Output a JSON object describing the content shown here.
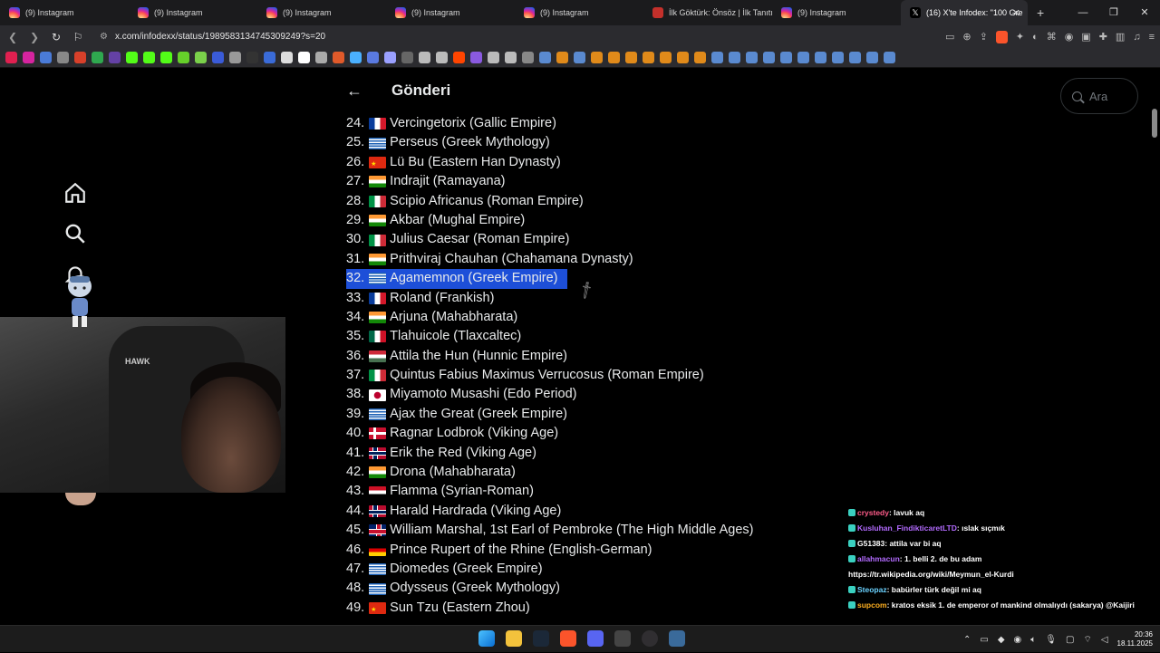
{
  "browser": {
    "tabs": [
      {
        "title": "(9) Instagram",
        "icon": "instagram-icon"
      },
      {
        "title": "(9) Instagram",
        "icon": "instagram-icon"
      },
      {
        "title": "(9) Instagram",
        "icon": "instagram-icon"
      },
      {
        "title": "(9) Instagram",
        "icon": "instagram-icon"
      },
      {
        "title": "(9) Instagram",
        "icon": "instagram-icon"
      },
      {
        "title": "İlk Göktürk: Önsöz | İlk Tanıtım",
        "icon": "youtube-icon"
      },
      {
        "title": "(9) Instagram",
        "icon": "instagram-icon"
      },
      {
        "title": "(16) X'te Infodex: \"100 Gre",
        "icon": "x-icon",
        "active": true
      }
    ],
    "url": "x.com/infodexx/status/1989583134745309249?s=20"
  },
  "header": {
    "back_icon": "arrow-left-icon",
    "title": "Gönderi"
  },
  "search": {
    "placeholder": "Ara"
  },
  "list": [
    {
      "num": "24.",
      "flag": "fr",
      "text": "Vercingetorix (Gallic Empire)"
    },
    {
      "num": "25.",
      "flag": "gr",
      "text": "Perseus (Greek Mythology)"
    },
    {
      "num": "26.",
      "flag": "cn",
      "text": "Lü Bu (Eastern Han Dynasty)"
    },
    {
      "num": "27.",
      "flag": "in",
      "text": "Indrajit (Ramayana)"
    },
    {
      "num": "28.",
      "flag": "it",
      "text": "Scipio Africanus (Roman Empire)"
    },
    {
      "num": "29.",
      "flag": "in",
      "text": "Akbar (Mughal Empire)"
    },
    {
      "num": "30.",
      "flag": "it",
      "text": "Julius Caesar (Roman Empire)"
    },
    {
      "num": "31.",
      "flag": "in",
      "text": "Prithviraj Chauhan (Chahamana Dynasty)"
    },
    {
      "num": "32.",
      "flag": "gr",
      "text": "Agamemnon (Greek Empire)",
      "selected": true
    },
    {
      "num": "33.",
      "flag": "fr",
      "text": "Roland (Frankish)"
    },
    {
      "num": "34.",
      "flag": "in",
      "text": "Arjuna (Mahabharata)"
    },
    {
      "num": "35.",
      "flag": "mx",
      "text": "Tlahuicole (Tlaxcaltec)"
    },
    {
      "num": "36.",
      "flag": "hu",
      "text": "Attila the Hun (Hunnic Empire)"
    },
    {
      "num": "37.",
      "flag": "it",
      "text": "Quintus Fabius Maximus Verrucosus (Roman Empire)"
    },
    {
      "num": "38.",
      "flag": "jp",
      "text": "Miyamoto Musashi (Edo Period)"
    },
    {
      "num": "39.",
      "flag": "gr",
      "text": "Ajax the Great (Greek Empire)"
    },
    {
      "num": "40.",
      "flag": "dk",
      "text": "Ragnar Lodbrok (Viking Age)"
    },
    {
      "num": "41.",
      "flag": "no",
      "text": "Erik the Red (Viking Age)"
    },
    {
      "num": "42.",
      "flag": "in",
      "text": "Drona (Mahabharata)"
    },
    {
      "num": "43.",
      "flag": "sy",
      "text": "Flamma (Syrian-Roman)"
    },
    {
      "num": "44.",
      "flag": "no",
      "text": "Harald Hardrada (Viking Age)"
    },
    {
      "num": "45.",
      "flag": "gb",
      "text": "William Marshal, 1st Earl of Pembroke (The High Middle Ages)"
    },
    {
      "num": "46.",
      "flag": "de",
      "text": "Prince Rupert of the Rhine (English-German)"
    },
    {
      "num": "47.",
      "flag": "gr",
      "text": "Diomedes (Greek Empire)"
    },
    {
      "num": "48.",
      "flag": "gr",
      "text": "Odysseus (Greek Mythology)"
    },
    {
      "num": "49.",
      "flag": "cn",
      "text": "Sun Tzu (Eastern Zhou)"
    }
  ],
  "webcam": {
    "chair_logo": "HAWK"
  },
  "chat": [
    {
      "user": "crystedy",
      "color": "#ff5c8a",
      "message": ": lavuk aq"
    },
    {
      "user": "Kusluhan_FindikticaretLTD",
      "color": "#b36bff",
      "message": ": ıslak sıçmık"
    },
    {
      "user": "G51383",
      "color": "#ffffff",
      "message": ": attila var bi aq"
    },
    {
      "user": "allahmacun",
      "color": "#b36bff",
      "message": ": 1. belli 2. de bu adam"
    },
    {
      "user": "",
      "color": "#ffffff",
      "message": "https://tr.wikipedia.org/wiki/Meymun_el-Kurdi"
    },
    {
      "user": "Steopaz",
      "color": "#6ad2ff",
      "message": ": babürler türk değil mi aq"
    },
    {
      "user": "supcom",
      "color": "#ffb020",
      "message": ": kratos eksik 1. de emperor of mankind olmalıydı (sakarya) @Kaijiri"
    }
  ],
  "taskbar": {
    "time": "20:36",
    "date": "18.11.2025"
  },
  "colors": {
    "selection": "#1d4fd8",
    "background": "#000000",
    "text": "#e7e9ea"
  }
}
